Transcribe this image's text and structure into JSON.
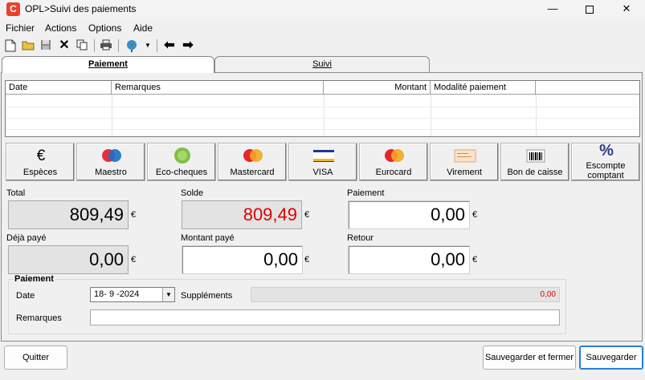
{
  "window": {
    "title": "OPL>Suivi des paiements",
    "minimize": "—",
    "close": "✕"
  },
  "menu": [
    "Fichier",
    "Actions",
    "Options",
    "Aide"
  ],
  "tabs": [
    {
      "label": "Paiement",
      "active": true
    },
    {
      "label": "Suivi",
      "active": false
    }
  ],
  "table": {
    "headers": [
      "Date",
      "Remarques",
      "Montant",
      "Modalité paiement",
      ""
    ],
    "rows": []
  },
  "payment_methods": [
    {
      "label": "Espèces",
      "icon": "euro-icon"
    },
    {
      "label": "Maestro",
      "icon": "maestro-card-icon"
    },
    {
      "label": "Eco-cheques",
      "icon": "eco-cheque-icon"
    },
    {
      "label": "Mastercard",
      "icon": "mastercard-icon"
    },
    {
      "label": "VISA",
      "icon": "visa-card-icon"
    },
    {
      "label": "Eurocard",
      "icon": "eurocard-icon"
    },
    {
      "label": "Virement",
      "icon": "bank-transfer-icon"
    },
    {
      "label": "Bon de caisse",
      "icon": "barcode-voucher-icon"
    },
    {
      "label": "Escompte comptant",
      "icon": "percent-discount-icon"
    }
  ],
  "amounts": {
    "total": {
      "label": "Total",
      "value": "809,49"
    },
    "solde": {
      "label": "Solde",
      "value": "809,49"
    },
    "paiement": {
      "label": "Paiement",
      "value": "0,00"
    },
    "deja_paye": {
      "label": "Déjà payé",
      "value": "0,00"
    },
    "montant_paye": {
      "label": "Montant payé",
      "value": "0,00"
    },
    "retour": {
      "label": "Retour",
      "value": "0,00"
    },
    "currency": "€"
  },
  "paiement_group": {
    "title": "Paiement",
    "date_label": "Date",
    "date_value": "18- 9 -2024",
    "supplements_label": "Suppléments",
    "supplements_value": "0,00",
    "remarques_label": "Remarques",
    "remarques_value": ""
  },
  "buttons": {
    "quit": "Quitter",
    "save_close": "Sauvegarder et fermer",
    "save": "Sauvegarder"
  },
  "colors": {
    "solde_value": "#e00000",
    "accent": "#2a7fd4",
    "app_icon": "#e8412c"
  }
}
